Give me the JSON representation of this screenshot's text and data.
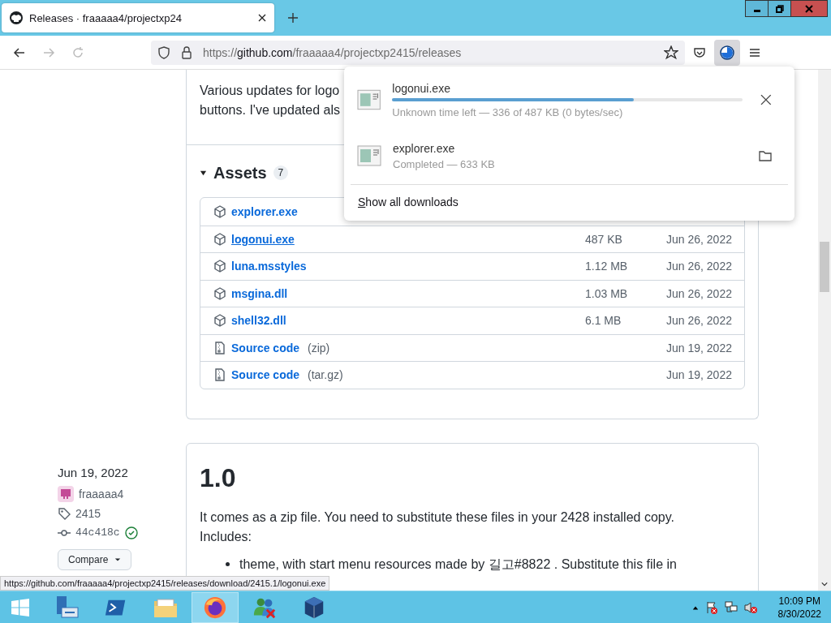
{
  "browser": {
    "tabs": [
      {
        "title": "Releases · fraaaaa4/projectxp24",
        "selected": true
      }
    ],
    "url": {
      "scheme": "https://",
      "host": "github.com",
      "path": "/fraaaaa4/projectxp2415/releases"
    }
  },
  "downloads_panel": {
    "items": [
      {
        "kind": "active",
        "name": "logonui.exe",
        "status": "Unknown time left — 336 of 487 KB (0 bytes/sec)",
        "level": 0.69
      },
      {
        "kind": "done",
        "name": "explorer.exe",
        "status": "Completed — 633 KB"
      }
    ],
    "footer": "Show all downloads"
  },
  "release_top": {
    "description_lines": [
      "Various updates for logo",
      "buttons. I've updated als"
    ],
    "assets": {
      "title": "Assets",
      "count": "7",
      "expanded": true,
      "rows": [
        {
          "kind": "package",
          "name": "explorer.exe",
          "hovered": false
        },
        {
          "kind": "package",
          "name": "logonui.exe",
          "size": "487 KB",
          "date": "Jun 26, 2022",
          "hovered": true
        },
        {
          "kind": "package",
          "name": "luna.msstyles",
          "size": "1.12 MB",
          "date": "Jun 26, 2022",
          "hovered": false
        },
        {
          "kind": "package",
          "name": "msgina.dll",
          "size": "1.03 MB",
          "date": "Jun 26, 2022",
          "hovered": false
        },
        {
          "kind": "package",
          "name": "shell32.dll",
          "size": "6.1 MB",
          "date": "Jun 26, 2022",
          "hovered": false
        },
        {
          "kind": "source",
          "name": "Source code",
          "format": "(zip)",
          "date": "Jun 19, 2022",
          "hovered": false
        },
        {
          "kind": "source",
          "name": "Source code",
          "format": "(tar.gz)",
          "date": "Jun 19, 2022",
          "hovered": false
        }
      ]
    }
  },
  "release_next": {
    "date": "Jun 19, 2022",
    "author": "fraaaaa4",
    "tag": "2415",
    "commit": "44c418c",
    "verified": true,
    "compare": "Compare",
    "title": "1.0",
    "paragraphs": [
      "It comes as a zip file. You need to substitute these files in your 2428 installed copy.",
      "Includes:"
    ],
    "bullets": [
      "theme, with start menu resources made by 길고#8822 . Substitute this file in"
    ]
  },
  "status_url": "https://github.com/fraaaaa4/projectxp2415/releases/download/2415.1/logonui.exe",
  "taskbar": {
    "apps": [
      {
        "kind": "server",
        "active": false
      },
      {
        "kind": "shell",
        "active": false
      },
      {
        "kind": "folder",
        "active": false
      },
      {
        "kind": "firefox",
        "active": true
      },
      {
        "kind": "people",
        "active": false
      },
      {
        "kind": "cube",
        "active": false
      }
    ],
    "clock": {
      "time": "10:09 PM",
      "date": "8/30/2022"
    }
  }
}
